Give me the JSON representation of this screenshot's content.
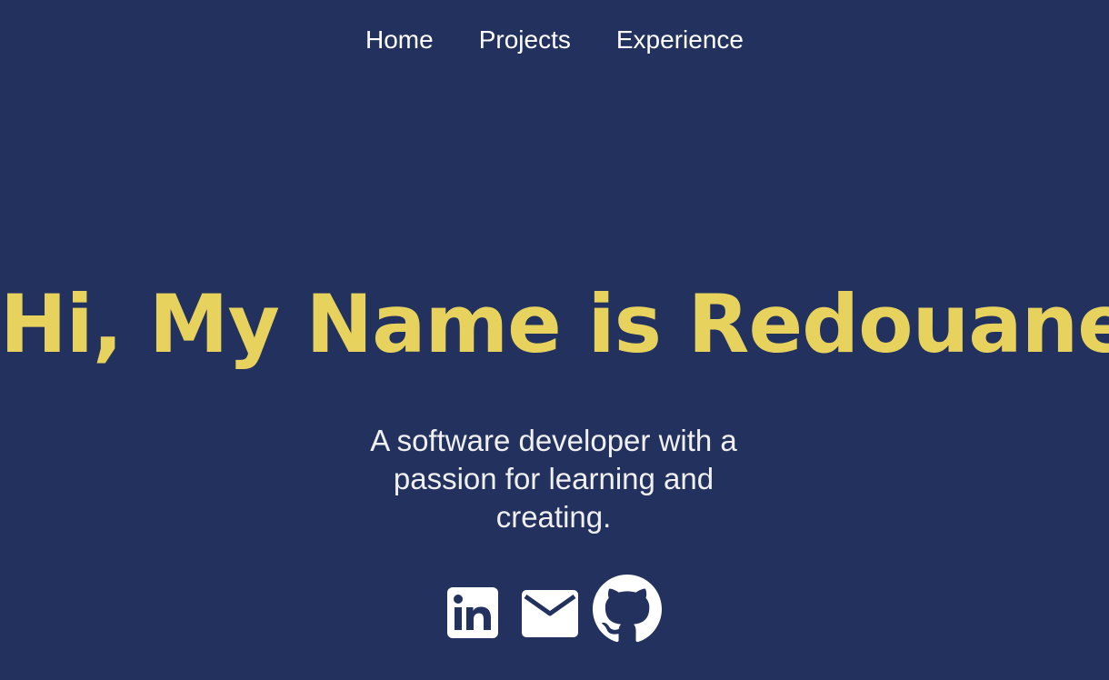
{
  "nav": {
    "items": [
      {
        "label": "Home"
      },
      {
        "label": "Projects"
      },
      {
        "label": "Experience"
      }
    ]
  },
  "hero": {
    "title": "Hi, My Name is Redouane",
    "tagline": "A software developer with a passion for learning and creating."
  },
  "social": {
    "links": [
      {
        "icon": "linkedin-icon"
      },
      {
        "icon": "mail-icon"
      },
      {
        "icon": "github-icon"
      }
    ]
  },
  "colors": {
    "background": "#22315e",
    "accent": "#e8d25e",
    "text": "#ffffff"
  }
}
